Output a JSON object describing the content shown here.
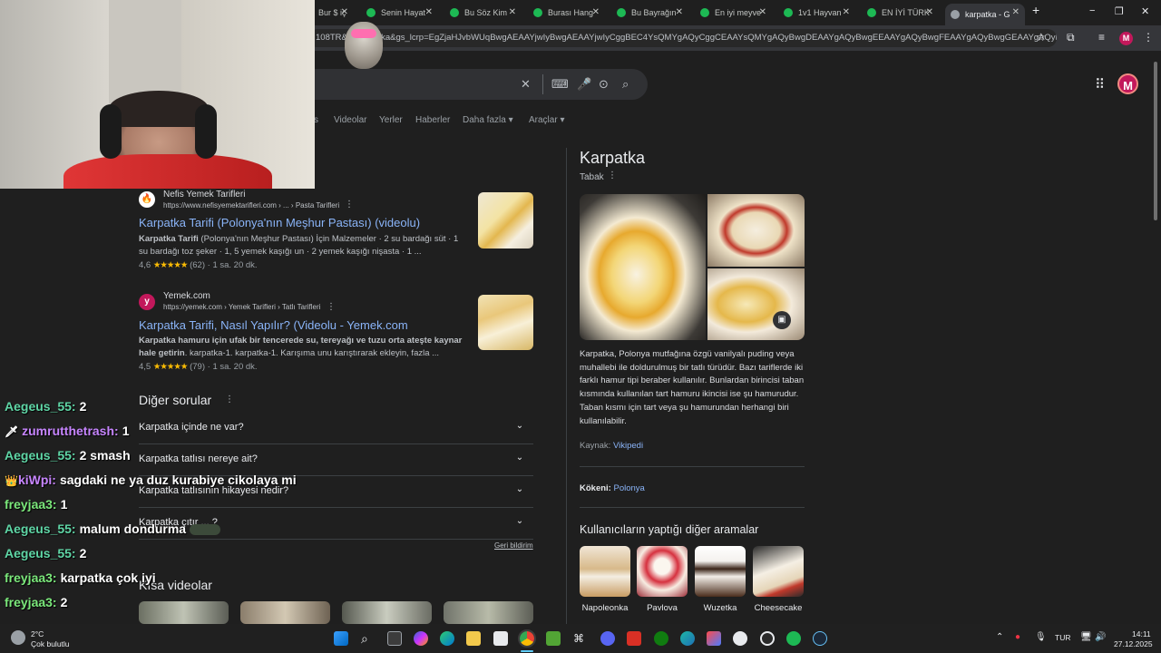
{
  "browser": {
    "tabs": [
      {
        "label": "Bur $ iç"
      },
      {
        "label": "Senin Hayat"
      },
      {
        "label": "Bu Söz Kim"
      },
      {
        "label": "Burası Hang"
      },
      {
        "label": "Bu Bayrağın"
      },
      {
        "label": "En iyi meyve"
      },
      {
        "label": "1v1 Hayvan"
      },
      {
        "label": "EN İYİ TÜRK"
      },
      {
        "label": "karpatka - G"
      }
    ],
    "url": "108TR&q=karpatka&gs_lcrp=EgZjaHJvbWUqBwgAEAAYjwIyBwgAEAAYjwIyCggBEC4YsQMYgAQyCggCEAAYsQMYgAQyBwgDEAAYgAQyBwgEEAAYgAQyBwgFEAAYgAQyBwgGEAAYgAQyBwgHEAAYgAQ...",
    "profile_initial": "M",
    "new_tab": "+",
    "minimize": "−",
    "maximize": "❐",
    "close": "✕"
  },
  "google": {
    "nav": [
      "s",
      "Videolar",
      "Yerler",
      "Haberler",
      "Daha fazla ▾",
      "Araçlar ▾"
    ],
    "clear_icon": "✕",
    "avatar_initial": "M"
  },
  "results": [
    {
      "site": "Nefis Yemek Tarifleri",
      "url": "https://www.nefisyemektarifleri.com › ... › Pasta Tarifleri",
      "title": "Karpatka Tarifi (Polonya'nın Meşhur Pastası) (videolu)",
      "snippet_bold": "Karpatka Tarifi",
      "snippet": " (Polonya'nın Meşhur Pastası) İçin Malzemeler · 2 su bardağı süt · 1 su bardağı toz şeker · 1, 5 yemek kaşığı un · 2 yemek kaşığı nişasta · 1 ...",
      "rating": "4,6",
      "stars": "★★★★★",
      "reviews": "(62)",
      "time": "· 1 sa. 20 dk."
    },
    {
      "site": "Yemek.com",
      "url": "https://yemek.com › Yemek Tarifleri › Tatlı Tarifleri",
      "title": "Karpatka Tarifi, Nasıl Yapılır? (Videolu - Yemek.com",
      "snippet_bold": "Karpatka hamuru için ufak bir tencerede su, tereyağı ve tuzu orta ateşte kaynar hale getirin",
      "snippet": ". karpatka-1. karpatka-1. Karışıma unu karıştırarak ekleyin, fazla ...",
      "rating": "4,5",
      "stars": "★★★★★",
      "reviews": "(79)",
      "time": "· 1 sa. 20 dk."
    }
  ],
  "faq": {
    "heading": "Diğer sorular",
    "questions": [
      "Karpatka içinde ne var?",
      "Karpatka tatlısı nereye ait?",
      "Karpatka tatlısının hikayesi nedir?",
      "Karpatka çıtır ... ?"
    ],
    "feedback": "Geri bildirim"
  },
  "short_videos": {
    "heading": "Kısa videolar"
  },
  "knowledge_panel": {
    "title": "Karpatka",
    "subtitle": "Tabak",
    "description": "Karpatka, Polonya mutfağına özgü vanilyalı puding veya muhallebi ile doldurulmuş bir tatlı türüdür. Bazı tariflerde iki farklı hamur tipi beraber kullanılır. Bunlardan birincisi taban kısmında kullanılan tart hamuru ikincisi ise şu hamurudur. Taban kısmı için tart veya şu hamurundan herhangi biri kullanılabilir.",
    "source_label": "Kaynak:",
    "source_link": "Vikipedi",
    "origin_label": "Kökeni:",
    "origin_value": "Polonya",
    "related_heading": "Kullanıcıların yaptığı diğer aramalar",
    "related": [
      "Napoleonka",
      "Pavlova",
      "Wuzetka",
      "Cheesecake"
    ]
  },
  "chat": [
    {
      "user": "Aegeus_55:",
      "msg": "2",
      "color": "#5fd6a6"
    },
    {
      "user": "zumrutthetrash:",
      "msg": "1",
      "color": "#c785ff",
      "badge": "🗡"
    },
    {
      "user": "Aegeus_55:",
      "msg": "2 smash",
      "color": "#5fd6a6"
    },
    {
      "user": "kiWpi:",
      "msg": "sagdaki ne ya duz kurabiye cikolaya mi",
      "color": "#c785ff",
      "badge": "👑"
    },
    {
      "user": "freyjaa3:",
      "msg": "1",
      "color": "#7be87b"
    },
    {
      "user": "Aegeus_55:",
      "msg": "malum dondurma",
      "color": "#5fd6a6"
    },
    {
      "user": "Aegeus_55:",
      "msg": "2",
      "color": "#5fd6a6"
    },
    {
      "user": "freyjaa3:",
      "msg": "karpatka çok iyi",
      "color": "#7be87b"
    },
    {
      "user": "freyjaa3:",
      "msg": "2",
      "color": "#7be87b"
    }
  ],
  "taskbar": {
    "weather_temp": "2°C",
    "weather_desc": "Çok bulutlu",
    "language": "TUR",
    "time": "14:11",
    "date": "27.12.2025"
  }
}
